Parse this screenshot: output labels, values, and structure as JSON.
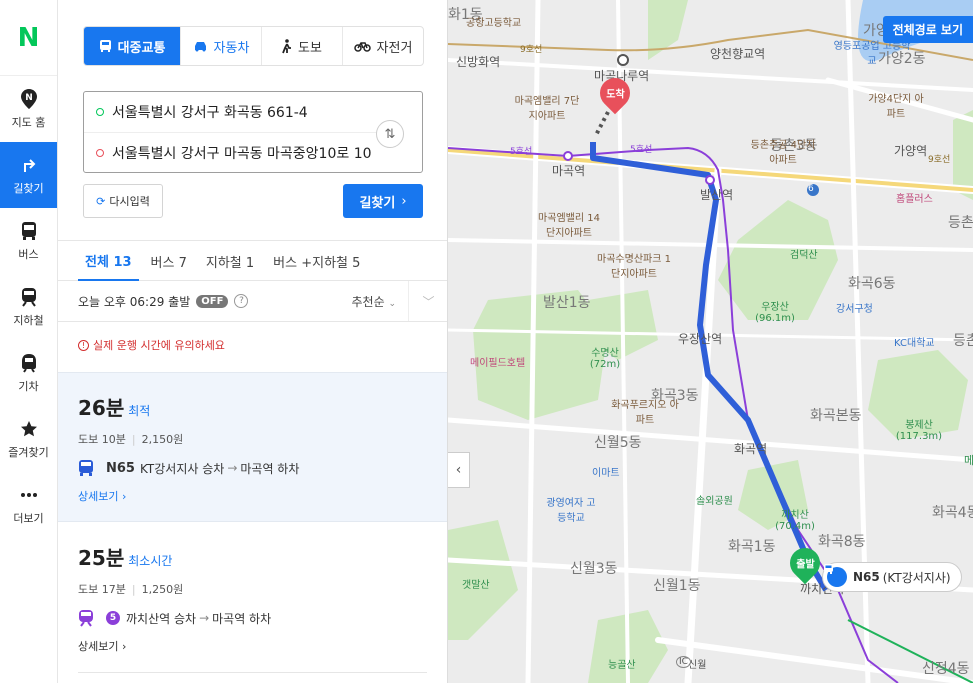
{
  "rail": {
    "logo": "N",
    "items": [
      {
        "label": "지도 홈",
        "icon": "map-pin-icon"
      },
      {
        "label": "길찾기",
        "icon": "directions-icon"
      },
      {
        "label": "버스",
        "icon": "bus-icon"
      },
      {
        "label": "지하철",
        "icon": "subway-icon"
      },
      {
        "label": "기차",
        "icon": "train-icon"
      },
      {
        "label": "즐겨찾기",
        "icon": "star-icon"
      },
      {
        "label": "더보기",
        "icon": "more-dots-icon"
      }
    ]
  },
  "modes": [
    "대중교통",
    "자동차",
    "도보",
    "자전거"
  ],
  "route": {
    "start": "서울특별시 강서구 화곡동 661-4",
    "end": "서울특별시 강서구 마곡동 마곡중앙10로 10"
  },
  "buttons": {
    "reset": "다시입력",
    "find": "길찾기"
  },
  "tabs": [
    "전체 13",
    "버스 7",
    "지하철 1",
    "버스 +지하철 5"
  ],
  "depart": {
    "text": "오늘 오후 06:29 출발",
    "badge": "OFF",
    "sort": "추천순"
  },
  "notice": "실제 운행 시간에 유의하세요",
  "results": [
    {
      "time": "26분",
      "tag": "최적",
      "walk": "도보 10분",
      "fare": "2,150원",
      "route": "N65",
      "board": "KT강서지사 승차",
      "alight": "마곡역 하차",
      "more": "상세보기"
    },
    {
      "time": "25분",
      "tag": "최소시간",
      "walk": "도보 17분",
      "fare": "1,250원",
      "line": "5",
      "board": "까치산역 승차",
      "alight": "마곡역 하차",
      "more": "상세보기"
    }
  ],
  "map": {
    "full_route_button": "전체경로 보기",
    "arrive_marker": "도착",
    "depart_marker": "출발",
    "bus_stop_chip": {
      "route": "N65",
      "stop": "(KT강서지사)"
    },
    "colors": {
      "route": "#2f5fd8",
      "line5": "#8b3fd9",
      "line9": "#c9a86a"
    },
    "labels": {
      "districts": [
        "발산1동",
        "화곡3동",
        "신월5동",
        "화곡1동",
        "화곡8동",
        "화곡본동",
        "화곡6동",
        "가양2동",
        "등촌3동",
        "신월3동",
        "신월1동",
        "가양1동",
        "화곡4동",
        "신정4동",
        "화1동",
        "등촌"
      ],
      "stations": [
        "신방화역",
        "마곡나루역",
        "양천향교역",
        "마곡역",
        "발산역",
        "우장산역",
        "화곡역",
        "까치산역",
        "가양역"
      ],
      "lines": [
        "9호선",
        "5호선",
        "5호선",
        "9호선"
      ],
      "pois": [
        "공항고등학교",
        "마곡엠밸리 7단지아파트",
        "마곡엠밸리 14단지아파트",
        "마곡수명산파크 1단지아파트",
        "등촌주공 4단지아파트",
        "영등포공업 고등학교",
        "가양4단지 아파트",
        "홈플러스",
        "강서구청",
        "KC대학교",
        "메이필드호텔",
        "화곡푸르지오 아파트",
        "이마트",
        "광영여자 고등학교",
        "솔외공원",
        "신월"
      ],
      "mountains": [
        "검덕산",
        "우장산 (96.1m)",
        "수명산 (72m)",
        "봉제산 (117.3m)",
        "까치산 (70.4m)",
        "갯말산",
        "능골산"
      ],
      "extra": [
        "6",
        "IC",
        "가양역",
        "메",
        "등촌"
      ]
    }
  }
}
